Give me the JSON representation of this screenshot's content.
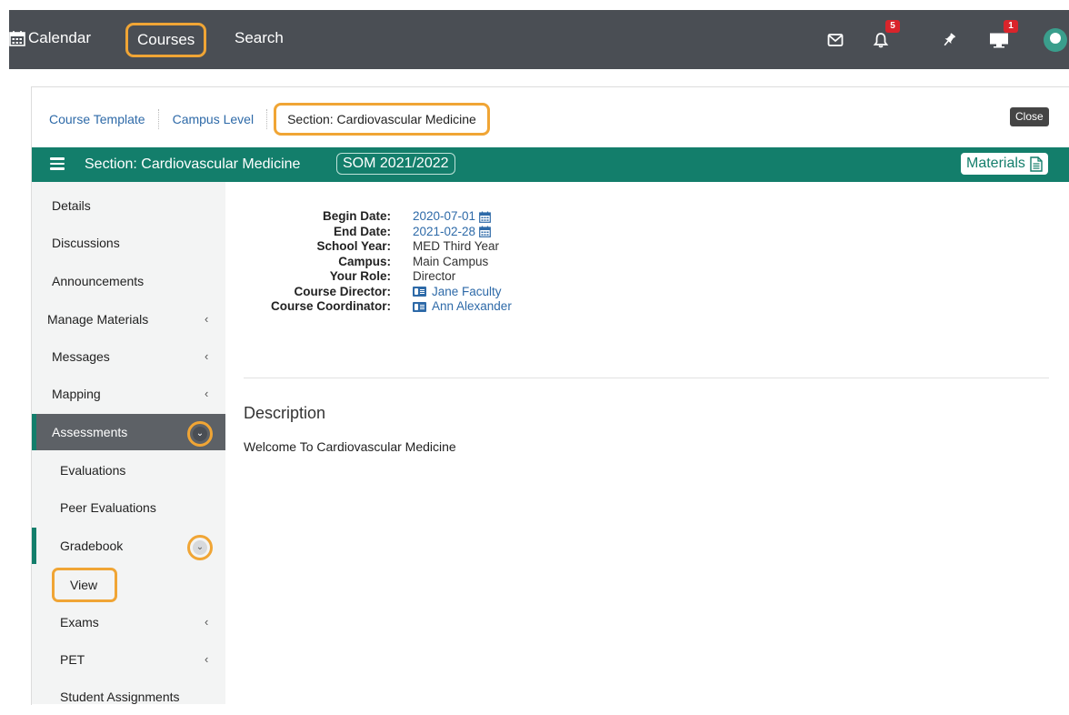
{
  "topnav": {
    "calendar": "Calendar",
    "courses": "Courses",
    "search": "Search",
    "notifications_count": "5",
    "messages_count": "1"
  },
  "breadcrumbs": [
    "Course Template",
    "Campus Level",
    "Section: Cardiovascular Medicine"
  ],
  "close_label": "Close",
  "section": {
    "title": "Section: Cardiovascular Medicine",
    "term": "SOM 2021/2022",
    "materials_label": "Materials"
  },
  "sidebar": [
    {
      "label": "Details"
    },
    {
      "label": "Discussions"
    },
    {
      "label": "Announcements"
    },
    {
      "label": "Manage Materials"
    },
    {
      "label": "Messages"
    },
    {
      "label": "Mapping"
    },
    {
      "label": "Assessments"
    },
    {
      "label": "Evaluations"
    },
    {
      "label": "Peer Evaluations"
    },
    {
      "label": "Gradebook"
    },
    {
      "label": "View"
    },
    {
      "label": "Exams"
    },
    {
      "label": "PET"
    },
    {
      "label": "Student Assignments"
    }
  ],
  "details": [
    {
      "label": "Begin Date:",
      "value": "2020-07-01"
    },
    {
      "label": "End Date:",
      "value": "2021-02-28"
    },
    {
      "label": "School Year:",
      "value": "MED Third Year"
    },
    {
      "label": "Campus:",
      "value": "Main Campus"
    },
    {
      "label": "Your Role:",
      "value": "Director"
    },
    {
      "label": "Course Director:",
      "value": "Jane Faculty"
    },
    {
      "label": "Course Coordinator:",
      "value": "Ann Alexander"
    }
  ],
  "description": {
    "heading": "Description",
    "text": "Welcome To Cardiovascular Medicine"
  },
  "colors": {
    "topbar": "#4a4e54",
    "accent": "#137e6b",
    "highlight": "#f0a535",
    "link": "#2e6aa8"
  }
}
